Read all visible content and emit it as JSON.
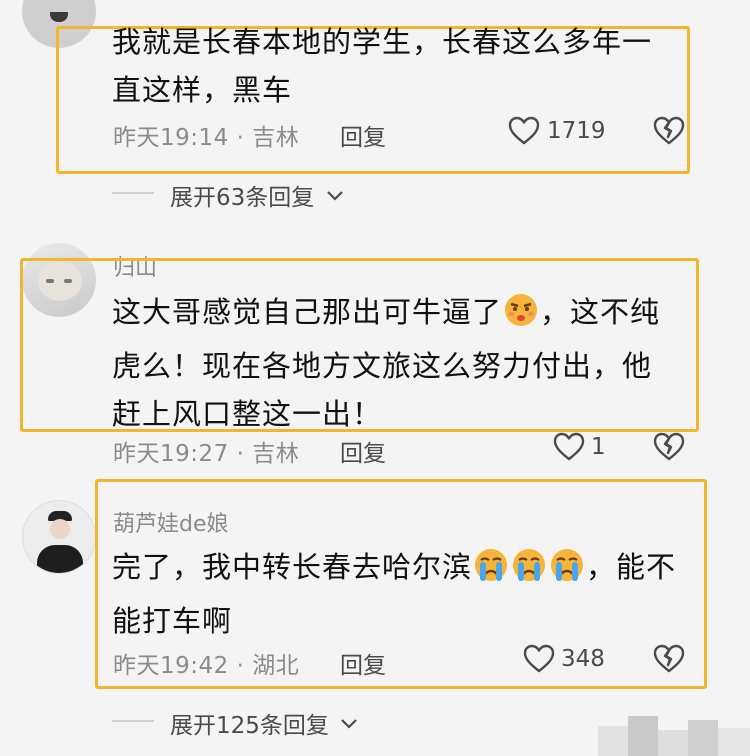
{
  "comments": [
    {
      "text_line1": "我就是长春本地的学生，长春这么多年一",
      "text_line2": "直这样，黑车",
      "time": "昨天19:14",
      "sep": "·",
      "location": "吉林",
      "reply_label": "回复",
      "likes": "1719"
    },
    {
      "username": "归山",
      "text_line1a": "这大哥感觉自己那出可牛逼了",
      "emoji1": "smirk-emoji",
      "text_line1b": "，这不纯",
      "text_line2": "虎么！现在各地方文旅这么努力付出，他",
      "text_line3": "赶上风口整这一出！",
      "time": "昨天19:27",
      "sep": "·",
      "location": "吉林",
      "reply_label": "回复",
      "likes": "1"
    },
    {
      "username": "葫芦娃de娘",
      "text_line1a": "完了，我中转长春去哈尔滨",
      "emoji1": "crying-emoji",
      "text_line1b": "，能不",
      "text_line2": "能打车啊",
      "time": "昨天19:42",
      "sep": "·",
      "location": "湖北",
      "reply_label": "回复",
      "likes": "348"
    }
  ],
  "expand": [
    {
      "label": "展开63条回复"
    },
    {
      "label": "展开125条回复"
    }
  ],
  "colors": {
    "highlight": "#f2b52c",
    "meta": "#8b8b8b",
    "background": "#f4f4f4"
  }
}
